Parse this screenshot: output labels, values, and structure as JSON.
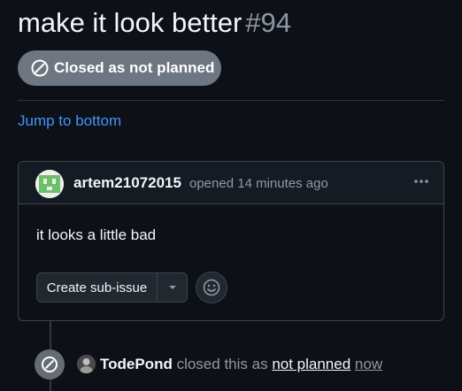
{
  "issue": {
    "title": "make it look better",
    "number": "#94",
    "state_label": "Closed as not planned",
    "state_color": "#6e7681"
  },
  "navigation": {
    "jump_label": "Jump to bottom"
  },
  "comment": {
    "author": "artem21072015",
    "meta": "opened 14 minutes ago",
    "body": "it looks a little bad",
    "menu_icon": "kebab-horizontal-icon",
    "create_subissue_label": "Create sub-issue",
    "caret_icon": "triangle-down-icon",
    "reaction_icon": "smiley-icon"
  },
  "event": {
    "actor": "TodePond",
    "action": "closed this as",
    "reason": "not planned",
    "time": "now",
    "icon": "skip-icon"
  },
  "colors": {
    "background": "#0d1117",
    "link": "#4493f8",
    "border": "#3d444d",
    "avatar_green": "#6bc167"
  }
}
